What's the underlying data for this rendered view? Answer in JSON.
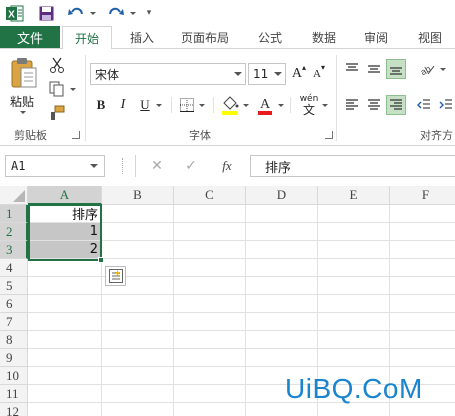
{
  "app": {
    "name": "Excel"
  },
  "quick_access": {
    "more_glyph": "▾"
  },
  "tabs": [
    {
      "label": "文件"
    },
    {
      "label": "开始"
    },
    {
      "label": "插入"
    },
    {
      "label": "页面布局"
    },
    {
      "label": "公式"
    },
    {
      "label": "数据"
    },
    {
      "label": "审阅"
    },
    {
      "label": "视图"
    }
  ],
  "ribbon": {
    "clipboard": {
      "paste_label": "粘贴",
      "group_label": "剪贴板"
    },
    "font": {
      "font_name": "宋体",
      "font_size": "11",
      "group_label": "字体",
      "bold": "B",
      "italic": "I",
      "underline": "U",
      "phonetic": "wén",
      "increase": "A",
      "decrease": "A"
    },
    "alignment": {
      "group_label": "对齐方"
    }
  },
  "formula_bar": {
    "name_box": "A1",
    "cancel": "✕",
    "enter": "✓",
    "fx": "fx",
    "content": "排序"
  },
  "grid": {
    "columns": [
      "A",
      "B",
      "C",
      "D",
      "E",
      "F"
    ],
    "rows": [
      "1",
      "2",
      "3",
      "4",
      "5",
      "6",
      "7",
      "8",
      "9",
      "10",
      "11",
      "12"
    ],
    "cells": {
      "A1": "排序",
      "A2": "1",
      "A3": "2"
    }
  },
  "colors": {
    "accent": "#217346",
    "selection_fill": "#c6c6c6",
    "watermark": "#1a85ce"
  },
  "watermark": "UiBQ.CoM"
}
